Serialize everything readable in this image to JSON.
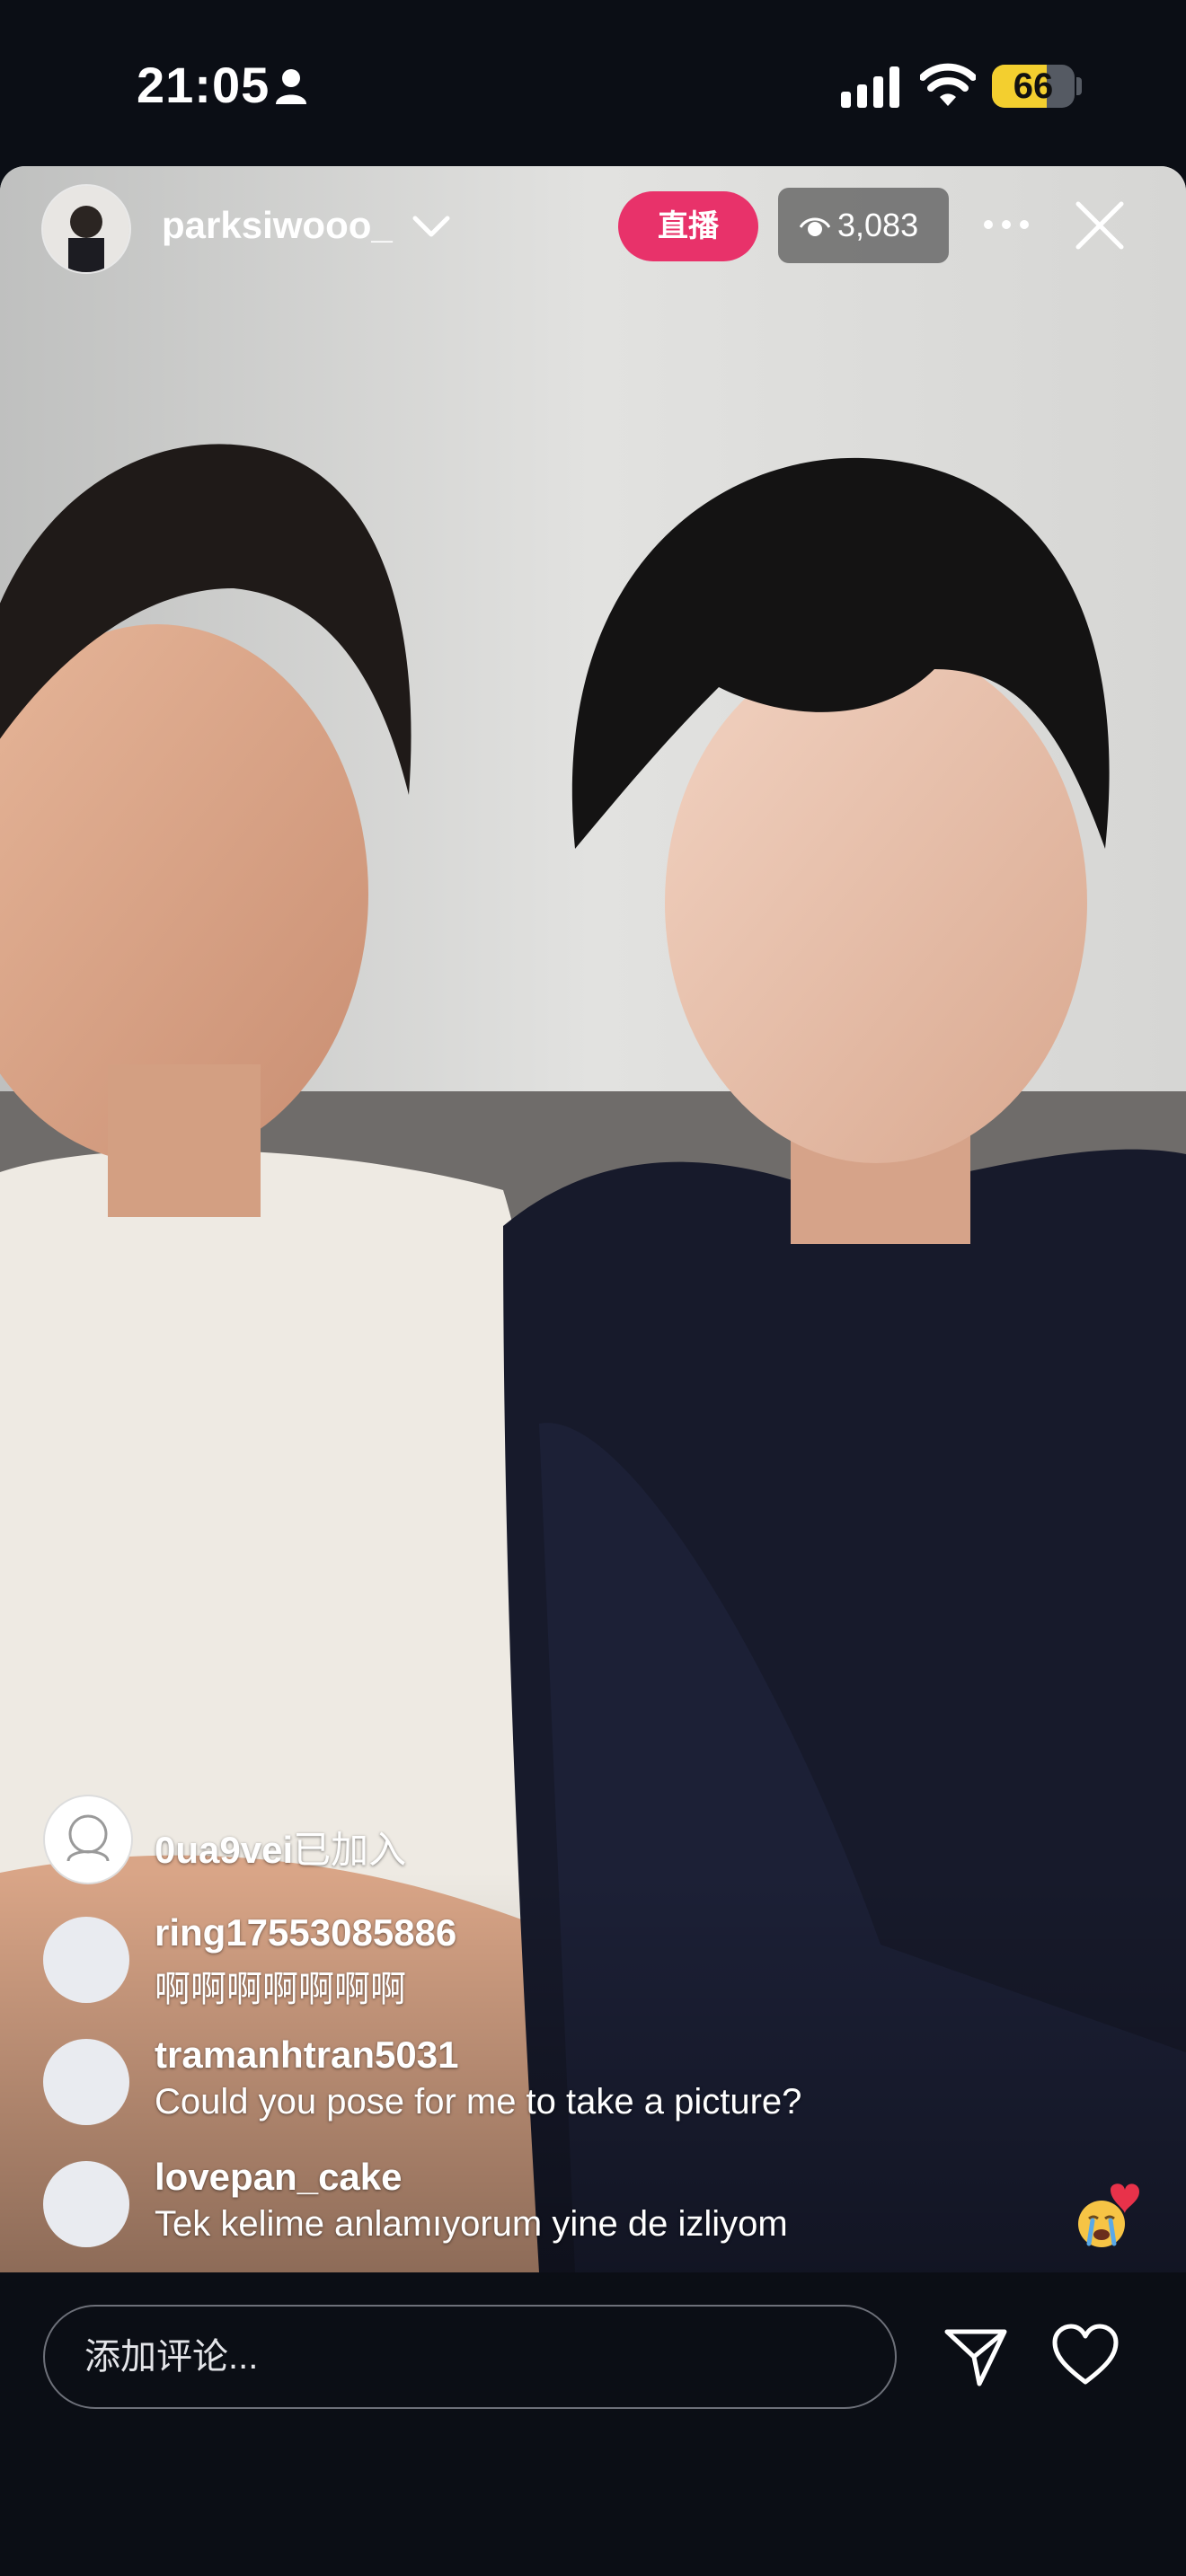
{
  "status_bar": {
    "time": "21:05",
    "battery": "66",
    "battery_level": 0.66
  },
  "live": {
    "username": "parksiwooo_",
    "live_label": "直播",
    "viewer_count": "3,083"
  },
  "comments": [
    {
      "type": "join",
      "user": "0ua9vei",
      "suffix": "已加入"
    },
    {
      "type": "comment",
      "user": "ring17553085886",
      "text": "啊啊啊啊啊啊啊"
    },
    {
      "type": "comment",
      "user": "tramanhtran5031",
      "text": "Could you pose for me to take a picture?"
    },
    {
      "type": "comment",
      "user": "lovepan_cake",
      "text": "Tek kelime anlamıyorum yine de izliyom"
    }
  ],
  "input": {
    "placeholder": "添加评论..."
  },
  "icons": {
    "person": "person-icon",
    "signal": "cellular-signal-icon",
    "wifi": "wifi-icon",
    "chevron": "chevron-down-icon",
    "eye": "eye-icon",
    "more": "more-icon",
    "close": "close-icon",
    "send": "send-icon",
    "heart": "heart-icon",
    "reaction": "crying-face-heart-icon"
  },
  "colors": {
    "live_badge": "#e8326a",
    "battery": "#f3cf2f",
    "background": "#0b0e15"
  }
}
